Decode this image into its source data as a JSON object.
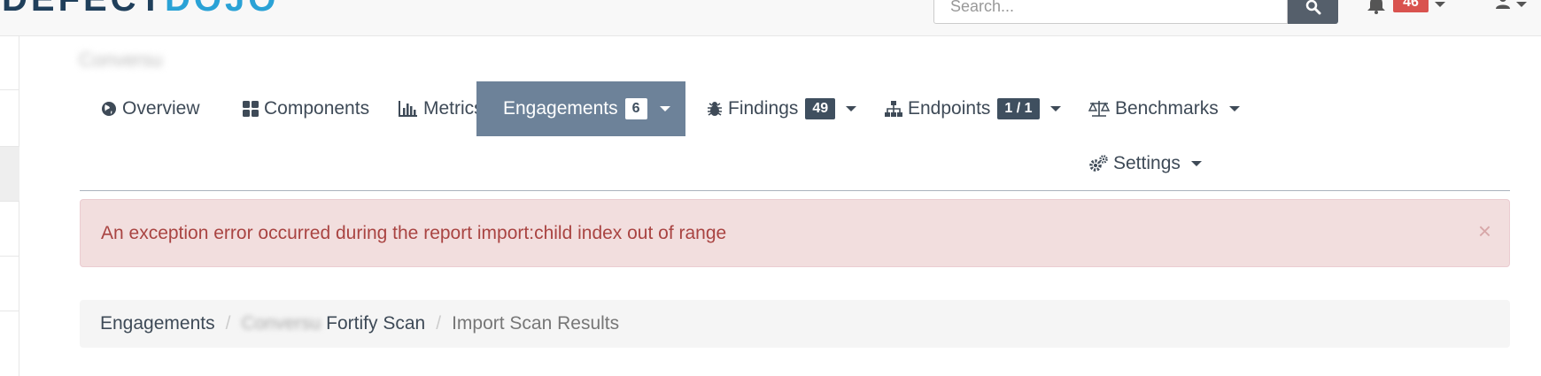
{
  "header": {
    "logo_part1": "DEFECT",
    "logo_part2": "DOJO",
    "search_placeholder": "Search...",
    "notification_count": "46"
  },
  "product": {
    "name": "Conversu"
  },
  "tabs": [
    {
      "label": "Overview",
      "icon": "globe-icon"
    },
    {
      "label": "Components",
      "icon": "grid-icon"
    },
    {
      "label": "Metrics",
      "icon": "bar-chart-icon"
    },
    {
      "label": "Engagements",
      "icon": "calendar-icon",
      "badge": "6",
      "active": true
    },
    {
      "label": "Findings",
      "icon": "bug-icon",
      "badge": "49"
    },
    {
      "label": "Endpoints",
      "icon": "sitemap-icon",
      "badge": "1 / 1"
    },
    {
      "label": "Benchmarks",
      "icon": "balance-scale-icon"
    },
    {
      "label": "Settings",
      "icon": "cogs-icon"
    }
  ],
  "alert": {
    "message": "An exception error occurred during the report import:child index out of range",
    "close": "×"
  },
  "breadcrumb": {
    "items": [
      "Engagements",
      "Conversu",
      "Fortify Scan",
      "Import Scan Results"
    ]
  },
  "colors": {
    "active_tab": "#6d8299",
    "badge_dark": "#3f4f5f",
    "alert_bg": "#f2dede",
    "alert_text": "#a94442",
    "notif_badge": "#d9534f"
  }
}
